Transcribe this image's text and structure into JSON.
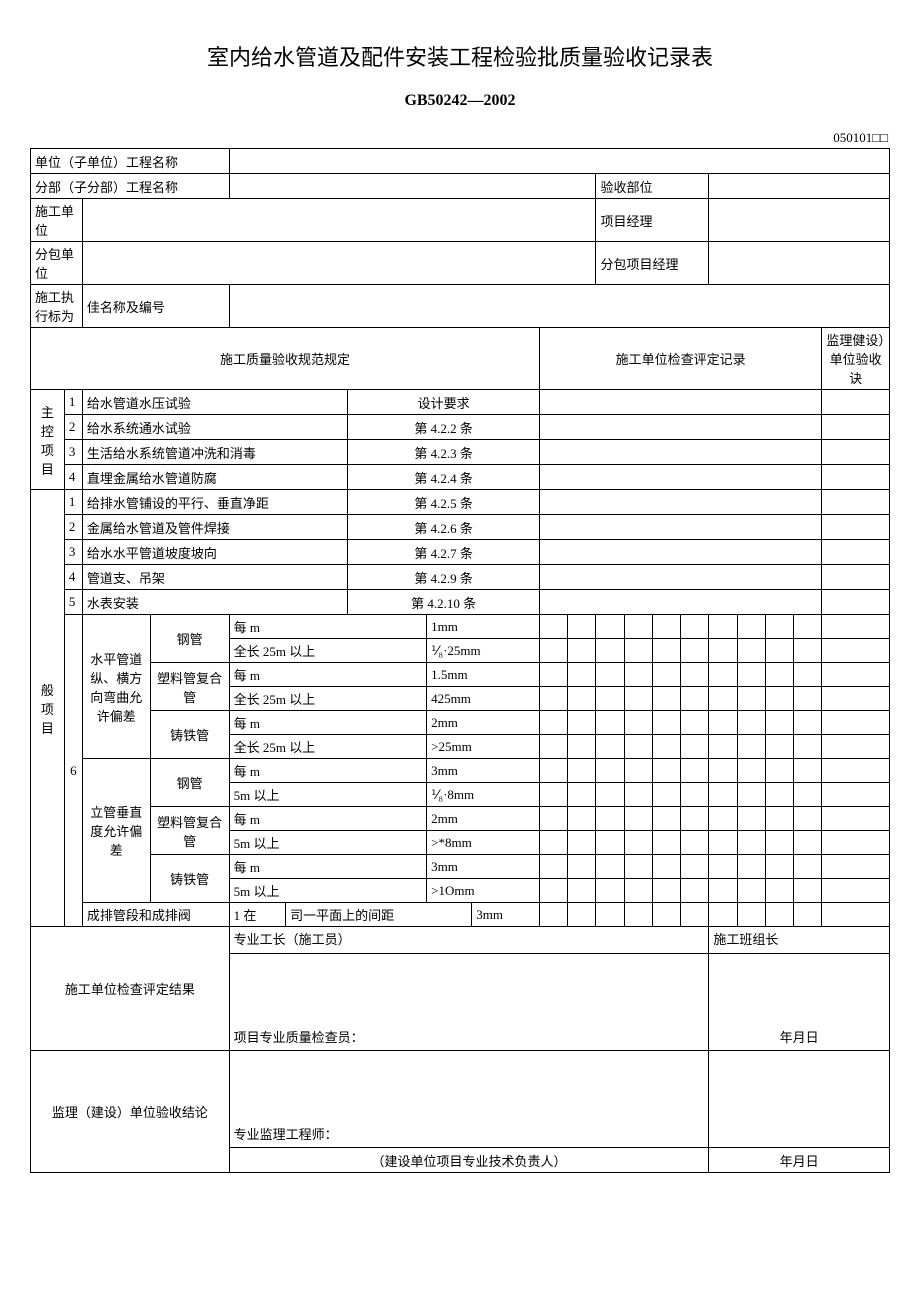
{
  "title": "室内给水管道及配件安装工程检验批质量验收记录表",
  "subtitle": "GB50242—2002",
  "code": "050101□□",
  "header_rows": {
    "r1_label": "单位（子单位）工程名称",
    "r2_label": "分部（子分部）工程名称",
    "r2_right": "验收部位",
    "r3_label": "施工单位",
    "r3_right": "项目经理",
    "r4_label": "分包单位",
    "r4_right": "分包项目经理",
    "r5_label": "施工执行标为",
    "r5_sub": "佳名称及编号"
  },
  "section_headers": {
    "spec": "施工质量验收规范规定",
    "record": "施工单位检查评定记录",
    "supervise": "监理健设）单位验收诀"
  },
  "main_ctrl_label": "主控项目",
  "main_ctrl": [
    {
      "n": "1",
      "item": "给水管道水压试验",
      "ref": "设计要求"
    },
    {
      "n": "2",
      "item": "给水系统通水试验",
      "ref": "第 4.2.2 条"
    },
    {
      "n": "3",
      "item": "生活给水系统管道冲洗和消毒",
      "ref": "第 4.2.3 条"
    },
    {
      "n": "4",
      "item": "直埋金属给水管道防腐",
      "ref": "第 4.2.4 条"
    }
  ],
  "general_label": "般项目",
  "general_simple": [
    {
      "n": "1",
      "item": "给排水管铺设的平行、垂直净距",
      "ref": "第 4.2.5 条"
    },
    {
      "n": "2",
      "item": "金属给水管道及管件焊接",
      "ref": "第 4.2.6 条"
    },
    {
      "n": "3",
      "item": "给水水平管道坡度坡向",
      "ref": "第 4.2.7 条"
    },
    {
      "n": "4",
      "item": "管道支、吊架",
      "ref": "第 4.2.9 条"
    },
    {
      "n": "5",
      "item": "水表安装",
      "ref": "第 4.2.10 条"
    }
  ],
  "g6": {
    "n": "6",
    "horiz_label": "水平管道纵、横方向弯曲允许偏差",
    "vert_label": "立管垂直度允许偏差",
    "pipes": {
      "steel": "钢管",
      "plastic": "塑料管复合管",
      "cast": "铸铁管"
    },
    "rows_h": [
      {
        "mat": "steel",
        "per": "每 m",
        "pv": "1mm",
        "all": "全长 25m 以上",
        "av": "⅟₈·25mm"
      },
      {
        "mat": "plastic",
        "per": "每 m",
        "pv": "1.5mm",
        "all": "全长 25m 以上",
        "av": "425mm"
      },
      {
        "mat": "cast",
        "per": "每 m",
        "pv": "2mm",
        "all": "全长 25m 以上",
        "av": ">25mm"
      }
    ],
    "rows_v": [
      {
        "mat": "steel",
        "per": "每 m",
        "pv": "3mm",
        "all": "5m 以上",
        "av": "⅟₈·8mm"
      },
      {
        "mat": "plastic",
        "per": "每 m",
        "pv": "2mm",
        "all": "5m 以上",
        "av": ">*8mm"
      },
      {
        "mat": "cast",
        "per": "每 m",
        "pv": "3mm",
        "all": "5m 以上",
        "av": ">1Omm"
      }
    ],
    "row_last": {
      "a": "成排管段和成排阀",
      "b": "1 在",
      "c": "司一平面上的间距",
      "d": "3mm"
    }
  },
  "footer": {
    "unit_result": "施工单位检查评定结果",
    "foreman": "专业工长（施工员）",
    "team_leader": "施工班组长",
    "inspector": "项目专业质量检查员：",
    "date1": "年月日",
    "supervise_result": "监理（建设）单位验收结论",
    "engineer": "专业监理工程师：",
    "owner": "（建设单位项目专业技术负责人）",
    "date2": "年月日"
  }
}
